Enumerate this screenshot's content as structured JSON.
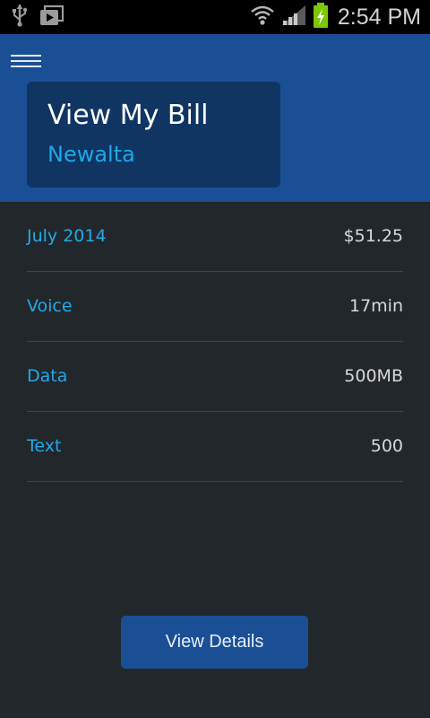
{
  "status_bar": {
    "time": "2:54 PM",
    "icons": [
      "usb-icon",
      "media-icon",
      "wifi-icon",
      "signal-icon",
      "battery-charging-icon"
    ],
    "battery_color": "#7cc70a"
  },
  "header": {
    "menu_icon": "hamburger-menu-icon",
    "background": "#1a4f96"
  },
  "bill_card": {
    "title": "View My Bill",
    "company": "Newalta"
  },
  "rows": [
    {
      "label": "July 2014",
      "value": "$51.25"
    },
    {
      "label": "Voice",
      "value": "17min"
    },
    {
      "label": "Data",
      "value": "500MB"
    },
    {
      "label": "Text",
      "value": "500"
    }
  ],
  "actions": {
    "view_details_label": "View Details"
  },
  "colors": {
    "accent": "#22a9e8",
    "primary": "#1a4f96",
    "background": "#22272b"
  }
}
